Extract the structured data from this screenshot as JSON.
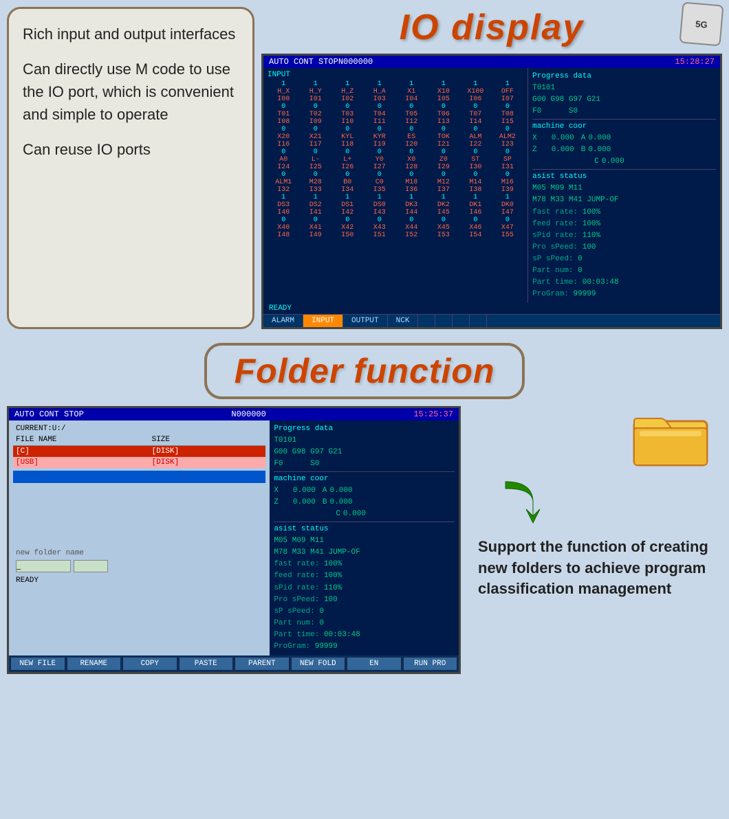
{
  "top": {
    "io_title": "IO display",
    "badge": "5G",
    "description_lines": [
      "Rich input and output interfaces",
      "Can directly use M code to use the IO port, which is convenient and simple to operate",
      "Can reuse IO ports"
    ],
    "screen": {
      "status": "AUTO  CONT  STOP",
      "n_code": "N000000",
      "time": "15:28:27",
      "input_label": "INPUT",
      "io_rows": [
        {
          "vals": [
            "1",
            "1",
            "1",
            "1",
            "1",
            "1",
            "1",
            "1"
          ],
          "labels": [
            "H_X",
            "H_Y",
            "H_Z",
            "H_A",
            "X1",
            "X10",
            "X100",
            "OFF"
          ]
        },
        {
          "vals": [
            "",
            "",
            "",
            "",
            "",
            "",
            "",
            ""
          ],
          "labels": [
            "I00",
            "I01",
            "I02",
            "I03",
            "I04",
            "I05",
            "I06",
            "I07"
          ]
        },
        {
          "vals": [
            "0",
            "0",
            "0",
            "0",
            "0",
            "0",
            "0",
            "0"
          ],
          "labels": [
            "T01",
            "T02",
            "T03",
            "T04",
            "T05",
            "T06",
            "T07",
            "T08"
          ]
        },
        {
          "vals": [
            "",
            "",
            "",
            "",
            "",
            "",
            "",
            ""
          ],
          "labels": [
            "I08",
            "I09",
            "I10",
            "I11",
            "I12",
            "I13",
            "I14",
            "I15"
          ]
        },
        {
          "vals": [
            "0",
            "0",
            "0",
            "0",
            "0",
            "0",
            "0",
            "0"
          ],
          "labels": [
            "X20",
            "X21",
            "KYL",
            "KYR",
            "ES",
            "TOK",
            "ALM",
            "ALM2"
          ]
        },
        {
          "vals": [
            "",
            "",
            "",
            "",
            "",
            "",
            "",
            ""
          ],
          "labels": [
            "I16",
            "I17",
            "I18",
            "I19",
            "I20",
            "I21",
            "I22",
            "I23"
          ]
        },
        {
          "vals": [
            "0",
            "0",
            "0",
            "0",
            "0",
            "0",
            "0",
            "0"
          ],
          "labels": [
            "A0",
            "L-",
            "L+",
            "Y0",
            "X0",
            "Z0",
            "ST",
            "SP"
          ]
        },
        {
          "vals": [
            "",
            "",
            "",
            "",
            "",
            "",
            "",
            ""
          ],
          "labels": [
            "I24",
            "I25",
            "I26",
            "I27",
            "I28",
            "I29",
            "I30",
            "I31"
          ]
        },
        {
          "vals": [
            "0",
            "0",
            "0",
            "0",
            "0",
            "0",
            "0",
            "0"
          ],
          "labels": [
            "ALM1",
            "M28",
            "B0",
            "C0",
            "M18",
            "M12",
            "M14",
            "M16"
          ]
        },
        {
          "vals": [
            "",
            "",
            "",
            "",
            "",
            "",
            "",
            ""
          ],
          "labels": [
            "I32",
            "I33",
            "I34",
            "I35",
            "I36",
            "I37",
            "I38",
            "I39"
          ]
        },
        {
          "vals": [
            "1",
            "1",
            "1",
            "1",
            "1",
            "1",
            "1",
            "1"
          ],
          "labels": [
            "DS3",
            "DS2",
            "DS1",
            "DS0",
            "DK3",
            "DK2",
            "DK1",
            "DK0"
          ]
        },
        {
          "vals": [
            "",
            "",
            "",
            "",
            "",
            "",
            "",
            ""
          ],
          "labels": [
            "I40",
            "I41",
            "I42",
            "I43",
            "I44",
            "I45",
            "I46",
            "I47"
          ]
        },
        {
          "vals": [
            "0",
            "0",
            "0",
            "0",
            "0",
            "0",
            "0",
            "0"
          ],
          "labels": [
            "X40",
            "X41",
            "X42",
            "X43",
            "X44",
            "X45",
            "X46",
            "X47"
          ]
        },
        {
          "vals": [
            "",
            "",
            "",
            "",
            "",
            "",
            "",
            ""
          ],
          "labels": [
            "I48",
            "I49",
            "I50",
            "I51",
            "I52",
            "I53",
            "I54",
            "I55"
          ]
        }
      ],
      "progress": {
        "title": "Progress data",
        "t_code": "T0101",
        "g_codes": "G00  G98  G97  G21",
        "f_label": "F0",
        "s_label": "S0",
        "machine_coor": "machine coor",
        "x_val": "0.000",
        "a_val": "0.000",
        "z_val": "0.000",
        "b_val": "0.000",
        "c_val": "0.000",
        "asist_status": "asist status",
        "m_codes1": "M05   M09   M11",
        "m_codes2": "M78   M33   M41 JUMP-OF",
        "fast_rate": "100%",
        "feed_rate": "100%",
        "spid_rate": "110%",
        "pro_speed": "100",
        "sp_speed": "0",
        "part_num": "0",
        "part_time": "00:03:48",
        "program": "99999"
      },
      "ready": "READY",
      "tabs": [
        "ALARM",
        "INPUT",
        "OUTPUT",
        "NCK",
        "",
        "",
        "",
        ""
      ]
    }
  },
  "bottom": {
    "folder_title": "Folder function",
    "screen2": {
      "status": "AUTO  CONT  STOP",
      "n_code": "N000000",
      "time": "15:25:37",
      "current_path": "CURRENT:U:/",
      "col_name": "FILE NAME",
      "col_size": "SIZE",
      "files": [
        {
          "name": "[C]",
          "size": "[DISK]",
          "selected": "c"
        },
        {
          "name": "[USB]",
          "size": "[DISK]",
          "selected": "usb"
        }
      ],
      "new_folder_label": "new folder name",
      "ready": "READY",
      "progress": {
        "title": "Progress data",
        "t_code": "T0101",
        "g_codes": "G00  G98  G97  G21",
        "f_label": "F0",
        "s_label": "S0",
        "machine_coor": "machine coor",
        "x_val": "0.000",
        "a_val": "0.000",
        "z_val": "0.000",
        "b_val": "0.000",
        "c_val": "0.000",
        "asist_status": "asist status",
        "m_codes1": "M05   M09   M11",
        "m_codes2": "M78   M33   M41 JUMP-OF",
        "fast_rate": "100%",
        "feed_rate": "100%",
        "spid_rate": "110%",
        "pro_speed": "100",
        "sp_speed": "0",
        "part_num": "0",
        "part_time": "00:03:48",
        "program": "99999"
      },
      "buttons": [
        "NEW FILE",
        "RENAME",
        "COPY",
        "PASTE",
        "PARENT",
        "NEW FOLD",
        "EN",
        "RUN PRO"
      ]
    },
    "description": "Support the function of creating new folders to achieve program classification management"
  }
}
